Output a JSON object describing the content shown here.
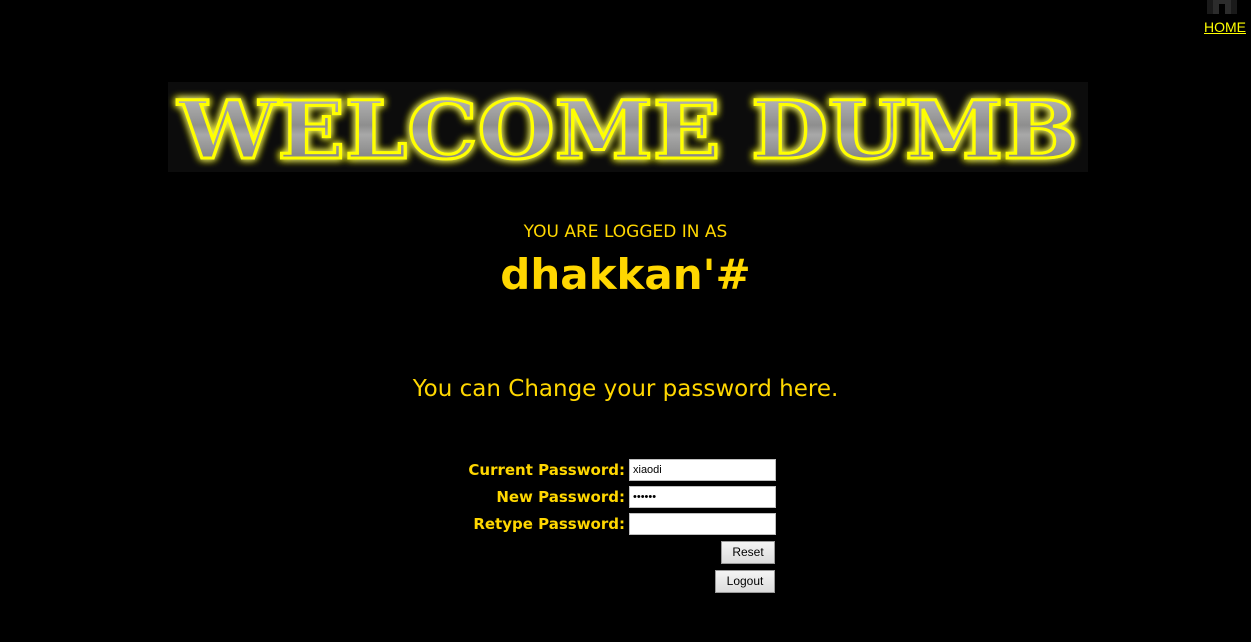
{
  "nav": {
    "home_label": "HOME"
  },
  "banner": {
    "text": "WELCOME DUMB"
  },
  "session": {
    "logged_in_label": "YOU ARE LOGGED IN AS",
    "username": "dhakkan'#"
  },
  "message": "You can Change your password here.",
  "form": {
    "current_password_label": "Current Password:",
    "current_password_value": "xiaodi",
    "new_password_label": "New Password:",
    "new_password_value": "••••••",
    "retype_password_label": "Retype Password:",
    "retype_password_value": "",
    "reset_label": "Reset",
    "logout_label": "Logout"
  },
  "colors": {
    "background": "#000000",
    "text": "#FFD700",
    "link": "#FFFF00",
    "banner_glow": "#FFFF00",
    "banner_metal": "#9a9a9a"
  },
  "icons": {
    "home": "home-icon"
  }
}
